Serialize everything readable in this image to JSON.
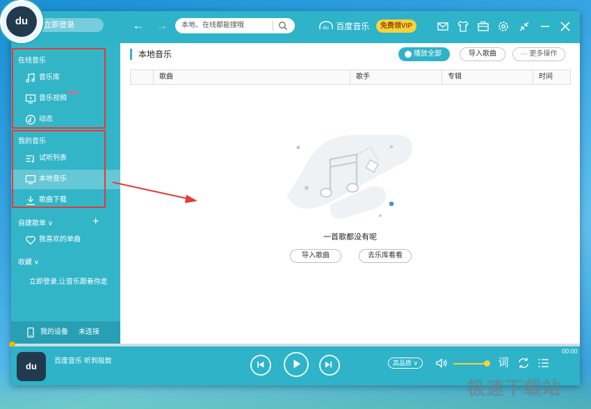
{
  "topbar": {
    "logo_text": "du",
    "login_label": "立即登录",
    "search_placeholder": "本地、在线都能搜哦",
    "brand_name": "百度音乐",
    "vip_label": "免费领VIP"
  },
  "sidebar": {
    "online_heading": "在线音乐",
    "online_items": [
      {
        "label": "音乐库",
        "icon": "music-note-icon"
      },
      {
        "label": "音乐视频",
        "icon": "monitor-icon",
        "badge": "NEW"
      },
      {
        "label": "动态",
        "icon": "activity-icon"
      }
    ],
    "my_heading": "我的音乐",
    "my_items": [
      {
        "label": "试听列表",
        "icon": "playlist-icon"
      },
      {
        "label": "本地音乐",
        "icon": "monitor-icon"
      },
      {
        "label": "歌曲下载",
        "icon": "download-icon"
      }
    ],
    "playlist_heading": "自建歌单",
    "favorite_item": "我喜欢的单曲",
    "collection_heading": "收藏",
    "login_prompt": "立即登录,让音乐跟着你走",
    "device_label": "我的设备",
    "device_status": "未连接"
  },
  "main": {
    "title": "本地音乐",
    "play_all": "播放全部",
    "import_songs": "导入歌曲",
    "more_actions": "更多操作",
    "columns": [
      "歌曲",
      "歌手",
      "专辑",
      "时间"
    ],
    "empty_text": "一首歌都没有呢",
    "empty_import": "导入歌曲",
    "empty_browse": "去乐库看看"
  },
  "player": {
    "song_title": "百度音乐 听到极致",
    "time": "00:00",
    "quality": "高品质",
    "lyrics_label": "词"
  },
  "watermark": "极速下载站",
  "colors": {
    "accent": "#2eb3c9",
    "vip": "#f6d23b",
    "highlight_box": "#e53935"
  }
}
